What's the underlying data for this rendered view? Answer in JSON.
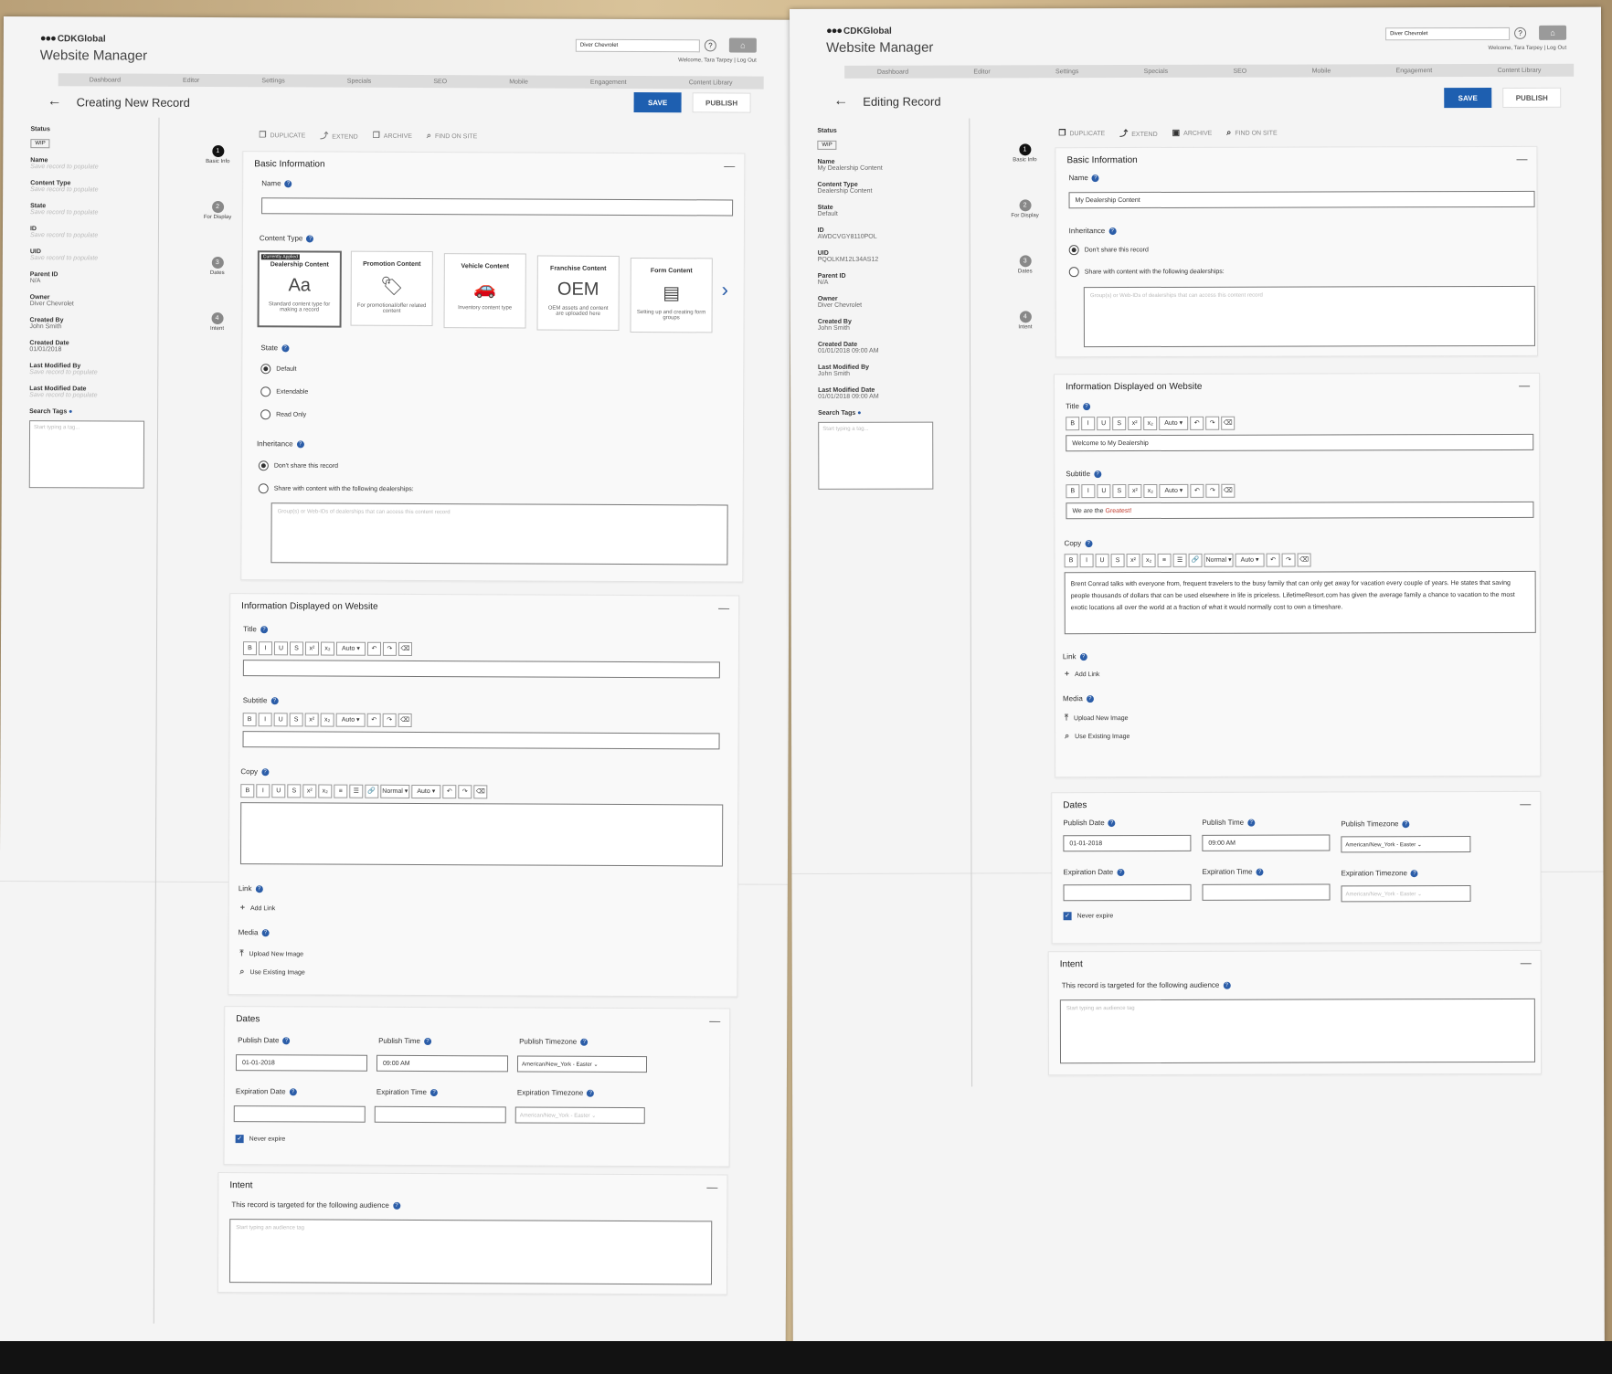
{
  "common": {
    "brand": "CDKGlobal",
    "app_name": "Website Manager",
    "dealer": "Diver Chevrolet",
    "welcome": "Welcome, Tara Tarpey | Log Out",
    "nav": [
      "Dashboard",
      "Editor",
      "Settings",
      "Specials",
      "SEO",
      "Mobile",
      "Engagement",
      "Content Library"
    ],
    "save": "SAVE",
    "publish": "PUBLISH",
    "toolbar": [
      "DUPLICATE",
      "EXTEND",
      "ARCHIVE",
      "FIND ON SITE"
    ],
    "steps": [
      {
        "num": "1",
        "label": "Basic Info"
      },
      {
        "num": "2",
        "label": "For Display"
      },
      {
        "num": "3",
        "label": "Dates"
      },
      {
        "num": "4",
        "label": "Intent"
      }
    ],
    "meta_labels": {
      "status": "Status",
      "name": "Name",
      "content_type": "Content Type",
      "state": "State",
      "id": "ID",
      "uid": "UID",
      "parent_id": "Parent ID",
      "owner": "Owner",
      "created_by": "Created By",
      "created_date": "Created Date",
      "last_modified_by": "Last Modified By",
      "last_modified_date": "Last Modified Date",
      "search_tags": "Search Tags"
    },
    "status_badge": "WIP",
    "tags_placeholder": "Start typing a tag...",
    "sections": {
      "basic": "Basic Information",
      "display": "Information Displayed on Website",
      "dates": "Dates",
      "intent": "Intent"
    },
    "fields": {
      "name": "Name",
      "content_type": "Content Type",
      "state": "State",
      "inheritance": "Inheritance",
      "title": "Title",
      "subtitle": "Subtitle",
      "copy": "Copy",
      "link": "Link",
      "media": "Media",
      "publish_date": "Publish Date",
      "publish_time": "Publish Time",
      "publish_tz": "Publish Timezone",
      "exp_date": "Expiration Date",
      "exp_time": "Expiration Time",
      "exp_tz": "Expiration Timezone",
      "intent_label": "This record is targeted for the following audience"
    },
    "state_options": [
      "Default",
      "Extendable",
      "Read Only"
    ],
    "inherit_options": [
      "Don't share this record",
      "Share with content with the following dealerships:"
    ],
    "inherit_placeholder": "Group(s) or Web-IDs of dealerships that can access this content record",
    "add_link": "Add Link",
    "upload_image": "Upload New Image",
    "use_existing": "Use Existing Image",
    "never_expire": "Never expire",
    "audience_placeholder": "Start typing an audience tag",
    "publish_date_val": "01-01-2018",
    "publish_time_val": "09:00 AM",
    "tz_val": "American/New_York - Easter",
    "content_types": [
      {
        "title": "Dealership Content",
        "icon": "Aa",
        "desc": "Standard content type for making a record",
        "applied": "Currently Applied"
      },
      {
        "title": "Promotion Content",
        "icon": "🏷",
        "desc": "For promotional/offer related content"
      },
      {
        "title": "Vehicle Content",
        "icon": "🚗",
        "desc": "Inventory content type"
      },
      {
        "title": "Franchise Content",
        "icon": "OEM",
        "desc": "OEM assets and content are uploaded here"
      },
      {
        "title": "Form Content",
        "icon": "▤",
        "desc": "Setting up and creating form groups"
      }
    ],
    "rte_small": [
      "B",
      "I",
      "U",
      "S",
      "x²",
      "x₂",
      "Auto ▾",
      "↶",
      "↷",
      "⌫"
    ],
    "rte_copy": [
      "B",
      "I",
      "U",
      "S",
      "x²",
      "x₂",
      "≡",
      "☰",
      "🔗",
      "Normal ▾",
      "Auto ▾",
      "↶",
      "↷",
      "⌫"
    ]
  },
  "left": {
    "page_title": "Creating New Record",
    "meta": {
      "name": "Save record to populate",
      "content_type": "Save record to populate",
      "state": "Save record to populate",
      "id": "Save record to populate",
      "uid": "Save record to populate",
      "parent_id": "N/A",
      "owner": "Diver Chevrolet",
      "created_by": "John Smith",
      "created_date": "01/01/2018",
      "last_modified_by": "Save record to populate",
      "last_modified_date": "Save record to populate"
    }
  },
  "right": {
    "page_title": "Editing Record",
    "meta": {
      "name": "My Dealership Content",
      "content_type": "Dealership Content",
      "state": "Default",
      "id": "AWDCVGY8110POL",
      "uid": "PQOLKM12L34AS12",
      "parent_id": "N/A",
      "owner": "Diver Chevrolet",
      "created_by": "John Smith",
      "created_date": "01/01/2018 09:00 AM",
      "last_modified_by": "John Smith",
      "last_modified_date": "01/01/2018 09:00 AM"
    },
    "name_val": "My Dealership Content",
    "title_val": "Welcome to My Dealership",
    "subtitle_prefix": "We are the ",
    "subtitle_highlight": "Greatest!",
    "copy_val": "Brent Conrad talks with everyone from, frequent travelers to the busy family that can only get away for vacation every couple of years. He states that saving people thousands of dollars that can be used elsewhere in life is priceless. LifetimeResort.com has given the average family a chance to vacation to the most exotic locations all over the world at a fraction of what it would normally cost to own a timeshare."
  }
}
